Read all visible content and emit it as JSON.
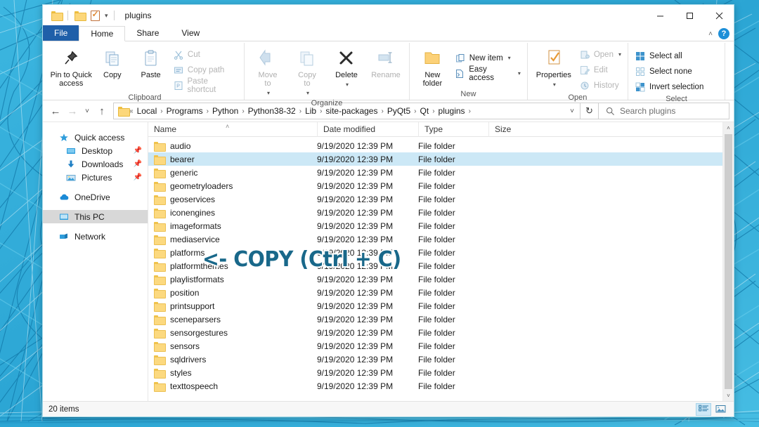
{
  "window": {
    "title": "plugins",
    "quick_access": [
      "folder-icon",
      "folder-icon",
      "properties-checkbox-icon",
      "chevron-down-icon"
    ],
    "controls": {
      "minimize": "─",
      "maximize": "☐",
      "close": "✕"
    }
  },
  "tabs": [
    {
      "label": "File",
      "kind": "file"
    },
    {
      "label": "Home",
      "kind": "active"
    },
    {
      "label": "Share",
      "kind": "normal"
    },
    {
      "label": "View",
      "kind": "normal"
    }
  ],
  "tab_right": {
    "collapse": "˄",
    "help": "?"
  },
  "ribbon": {
    "groups": [
      {
        "label": "Clipboard",
        "big": [
          {
            "label": "Pin to Quick\naccess",
            "icon": "pin-icon",
            "dim": false
          },
          {
            "label": "Copy",
            "icon": "copy-icon",
            "dim": false
          },
          {
            "label": "Paste",
            "icon": "paste-icon",
            "dim": false
          }
        ],
        "small": [
          {
            "label": "Cut",
            "icon": "scissors-icon",
            "dim": true
          },
          {
            "label": "Copy path",
            "icon": "copy-path-icon",
            "dim": true
          },
          {
            "label": "Paste shortcut",
            "icon": "paste-shortcut-icon",
            "dim": true
          }
        ]
      },
      {
        "label": "Organize",
        "big": [
          {
            "label": "Move\nto",
            "icon": "move-to-icon",
            "dim": true,
            "caret": true
          },
          {
            "label": "Copy\nto",
            "icon": "copy-to-icon",
            "dim": true,
            "caret": true
          },
          {
            "label": "Delete",
            "icon": "delete-x-icon",
            "dim": false,
            "caret": true
          },
          {
            "label": "Rename",
            "icon": "rename-icon",
            "dim": true
          }
        ],
        "small": []
      },
      {
        "label": "New",
        "big": [
          {
            "label": "New\nfolder",
            "icon": "new-folder-icon",
            "dim": false
          }
        ],
        "small": [
          {
            "label": "New item",
            "icon": "new-item-icon",
            "dim": false,
            "caret": true
          },
          {
            "label": "Easy access",
            "icon": "easy-access-icon",
            "dim": false,
            "caret": true
          }
        ]
      },
      {
        "label": "Open",
        "big": [
          {
            "label": "Properties",
            "icon": "properties-icon",
            "dim": false,
            "caret": true
          }
        ],
        "small": [
          {
            "label": "Open",
            "icon": "open-icon",
            "dim": true,
            "caret": true
          },
          {
            "label": "Edit",
            "icon": "edit-icon",
            "dim": true
          },
          {
            "label": "History",
            "icon": "history-icon",
            "dim": true
          }
        ]
      },
      {
        "label": "Select",
        "big": [],
        "small": [
          {
            "label": "Select all",
            "icon": "select-all-icon",
            "dim": false
          },
          {
            "label": "Select none",
            "icon": "select-none-icon",
            "dim": false
          },
          {
            "label": "Invert selection",
            "icon": "invert-selection-icon",
            "dim": false
          }
        ]
      }
    ]
  },
  "address": {
    "back": "←",
    "forward": "→",
    "recent": "˅",
    "up": "↑",
    "overflow": "«",
    "crumbs": [
      "Local",
      "Programs",
      "Python",
      "Python38-32",
      "Lib",
      "site-packages",
      "PyQt5",
      "Qt",
      "plugins"
    ],
    "dropdown_caret": "˅",
    "refresh": "↻"
  },
  "search": {
    "placeholder": "Search plugins",
    "icon": "search-icon"
  },
  "navpane": {
    "items": [
      {
        "label": "Quick access",
        "icon": "star-icon",
        "indent": false,
        "pinned": false,
        "selected": false
      },
      {
        "label": "Desktop",
        "icon": "desktop-icon",
        "indent": true,
        "pinned": true,
        "selected": false
      },
      {
        "label": "Downloads",
        "icon": "download-icon",
        "indent": true,
        "pinned": true,
        "selected": false
      },
      {
        "label": "Pictures",
        "icon": "pictures-icon",
        "indent": true,
        "pinned": true,
        "selected": false
      },
      {
        "label": "OneDrive",
        "icon": "cloud-icon",
        "indent": false,
        "pinned": false,
        "selected": false,
        "gap_before": true
      },
      {
        "label": "This PC",
        "icon": "monitor-icon",
        "indent": false,
        "pinned": false,
        "selected": true,
        "gap_before": true
      },
      {
        "label": "Network",
        "icon": "network-icon",
        "indent": false,
        "pinned": false,
        "selected": false,
        "gap_before": true
      }
    ],
    "pin_glyph": "📌"
  },
  "filelist": {
    "columns": [
      "Name",
      "Date modified",
      "Type",
      "Size"
    ],
    "sorted_by": "Name",
    "sort_glyph": "˄",
    "rows": [
      {
        "name": "audio",
        "date": "9/19/2020 12:39 PM",
        "type": "File folder",
        "size": "",
        "selected": false
      },
      {
        "name": "bearer",
        "date": "9/19/2020 12:39 PM",
        "type": "File folder",
        "size": "",
        "selected": true
      },
      {
        "name": "generic",
        "date": "9/19/2020 12:39 PM",
        "type": "File folder",
        "size": "",
        "selected": false
      },
      {
        "name": "geometryloaders",
        "date": "9/19/2020 12:39 PM",
        "type": "File folder",
        "size": "",
        "selected": false
      },
      {
        "name": "geoservices",
        "date": "9/19/2020 12:39 PM",
        "type": "File folder",
        "size": "",
        "selected": false
      },
      {
        "name": "iconengines",
        "date": "9/19/2020 12:39 PM",
        "type": "File folder",
        "size": "",
        "selected": false
      },
      {
        "name": "imageformats",
        "date": "9/19/2020 12:39 PM",
        "type": "File folder",
        "size": "",
        "selected": false
      },
      {
        "name": "mediaservice",
        "date": "9/19/2020 12:39 PM",
        "type": "File folder",
        "size": "",
        "selected": false
      },
      {
        "name": "platforms",
        "date": "9/19/2020 12:39 PM",
        "type": "File folder",
        "size": "",
        "selected": false
      },
      {
        "name": "platformthemes",
        "date": "9/19/2020 12:39 PM",
        "type": "File folder",
        "size": "",
        "selected": false
      },
      {
        "name": "playlistformats",
        "date": "9/19/2020 12:39 PM",
        "type": "File folder",
        "size": "",
        "selected": false
      },
      {
        "name": "position",
        "date": "9/19/2020 12:39 PM",
        "type": "File folder",
        "size": "",
        "selected": false
      },
      {
        "name": "printsupport",
        "date": "9/19/2020 12:39 PM",
        "type": "File folder",
        "size": "",
        "selected": false
      },
      {
        "name": "sceneparsers",
        "date": "9/19/2020 12:39 PM",
        "type": "File folder",
        "size": "",
        "selected": false
      },
      {
        "name": "sensorgestures",
        "date": "9/19/2020 12:39 PM",
        "type": "File folder",
        "size": "",
        "selected": false
      },
      {
        "name": "sensors",
        "date": "9/19/2020 12:39 PM",
        "type": "File folder",
        "size": "",
        "selected": false
      },
      {
        "name": "sqldrivers",
        "date": "9/19/2020 12:39 PM",
        "type": "File folder",
        "size": "",
        "selected": false
      },
      {
        "name": "styles",
        "date": "9/19/2020 12:39 PM",
        "type": "File folder",
        "size": "",
        "selected": false
      },
      {
        "name": "texttospeech",
        "date": "9/19/2020 12:39 PM",
        "type": "File folder",
        "size": "",
        "selected": false
      }
    ]
  },
  "scrollbar": {
    "up": "˄",
    "down": "˅"
  },
  "statusbar": {
    "item_count": "20 items",
    "views": [
      {
        "name": "details-view-icon",
        "active": true
      },
      {
        "name": "large-icons-view-icon",
        "active": false
      }
    ]
  },
  "annotation": {
    "text": "<- COPY (Ctrl + C)",
    "color": "#19688a",
    "outline_color": "#ffffff"
  },
  "colors": {
    "desktop": "#35b0dc",
    "file_tab": "#1f5fa9",
    "selection": "#cce8f6",
    "nav_selection": "#d8d8d8",
    "folder": "#fcd97f"
  }
}
